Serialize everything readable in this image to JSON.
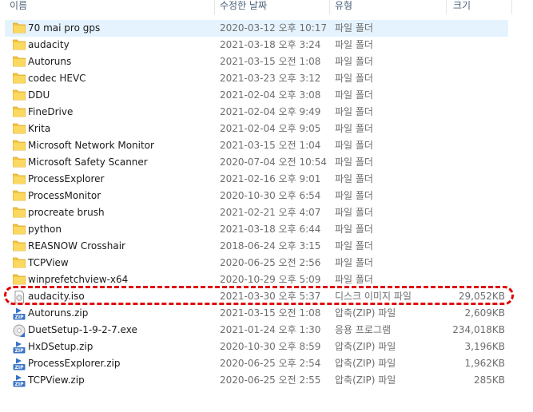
{
  "columns": {
    "name": "이름",
    "date": "수정한 날짜",
    "type": "유형",
    "size": "크기"
  },
  "files": [
    {
      "name": "70 mai pro gps",
      "date": "2020-03-12 오후 10:17",
      "type": "파일 폴더",
      "size": "",
      "icon": "folder-icon",
      "selected": true
    },
    {
      "name": "audacity",
      "date": "2021-03-18 오후 3:24",
      "type": "파일 폴더",
      "size": "",
      "icon": "folder-icon"
    },
    {
      "name": "Autoruns",
      "date": "2021-03-15 오전 1:08",
      "type": "파일 폴더",
      "size": "",
      "icon": "folder-icon"
    },
    {
      "name": "codec HEVC",
      "date": "2021-03-23 오후 3:12",
      "type": "파일 폴더",
      "size": "",
      "icon": "folder-icon"
    },
    {
      "name": "DDU",
      "date": "2021-02-04 오후 3:08",
      "type": "파일 폴더",
      "size": "",
      "icon": "folder-icon"
    },
    {
      "name": "FineDrive",
      "date": "2021-02-04 오후 9:49",
      "type": "파일 폴더",
      "size": "",
      "icon": "folder-icon"
    },
    {
      "name": "Krita",
      "date": "2021-02-04 오후 9:05",
      "type": "파일 폴더",
      "size": "",
      "icon": "folder-icon"
    },
    {
      "name": "Microsoft Network Monitor",
      "date": "2021-03-15 오전 1:04",
      "type": "파일 폴더",
      "size": "",
      "icon": "folder-icon"
    },
    {
      "name": "Microsoft Safety Scanner",
      "date": "2020-07-04 오전 10:54",
      "type": "파일 폴더",
      "size": "",
      "icon": "folder-icon"
    },
    {
      "name": "ProcessExplorer",
      "date": "2021-02-16 오후 9:01",
      "type": "파일 폴더",
      "size": "",
      "icon": "folder-icon"
    },
    {
      "name": "ProcessMonitor",
      "date": "2020-10-30 오후 6:54",
      "type": "파일 폴더",
      "size": "",
      "icon": "folder-icon"
    },
    {
      "name": "procreate brush",
      "date": "2021-02-21 오후 4:07",
      "type": "파일 폴더",
      "size": "",
      "icon": "folder-icon"
    },
    {
      "name": "python",
      "date": "2021-03-18 오후 6:44",
      "type": "파일 폴더",
      "size": "",
      "icon": "folder-icon"
    },
    {
      "name": "REASNOW Crosshair",
      "date": "2018-06-24 오후 3:15",
      "type": "파일 폴더",
      "size": "",
      "icon": "folder-icon"
    },
    {
      "name": "TCPView",
      "date": "2020-06-25 오전 2:56",
      "type": "파일 폴더",
      "size": "",
      "icon": "folder-icon"
    },
    {
      "name": "winprefetchview-x64",
      "date": "2020-10-29 오후 5:09",
      "type": "파일 폴더",
      "size": "",
      "icon": "folder-icon"
    },
    {
      "name": "audacity.iso",
      "date": "2021-03-30 오후 5:37",
      "type": "디스크 이미지 파일",
      "size": "29,052KB",
      "icon": "disc-image-icon"
    },
    {
      "name": "Autoruns.zip",
      "date": "2021-03-15 오전 1:08",
      "type": "압축(ZIP) 파일",
      "size": "2,609KB",
      "icon": "zip-icon"
    },
    {
      "name": "DuetSetup-1-9-2-7.exe",
      "date": "2021-01-24 오후 1:30",
      "type": "응용 프로그램",
      "size": "234,018KB",
      "icon": "setup-exe-icon"
    },
    {
      "name": "HxDSetup.zip",
      "date": "2020-10-30 오후 8:59",
      "type": "압축(ZIP) 파일",
      "size": "3,196KB",
      "icon": "zip-icon"
    },
    {
      "name": "ProcessExplorer.zip",
      "date": "2020-06-25 오후 2:54",
      "type": "압축(ZIP) 파일",
      "size": "1,962KB",
      "icon": "zip-icon"
    },
    {
      "name": "TCPView.zip",
      "date": "2020-06-25 오전 2:55",
      "type": "압축(ZIP) 파일",
      "size": "285KB",
      "icon": "zip-icon"
    }
  ],
  "colors": {
    "selection": "#e5f3ff",
    "folder": "#f5c542",
    "highlight": "#e00000",
    "header_text": "#4c607a"
  }
}
